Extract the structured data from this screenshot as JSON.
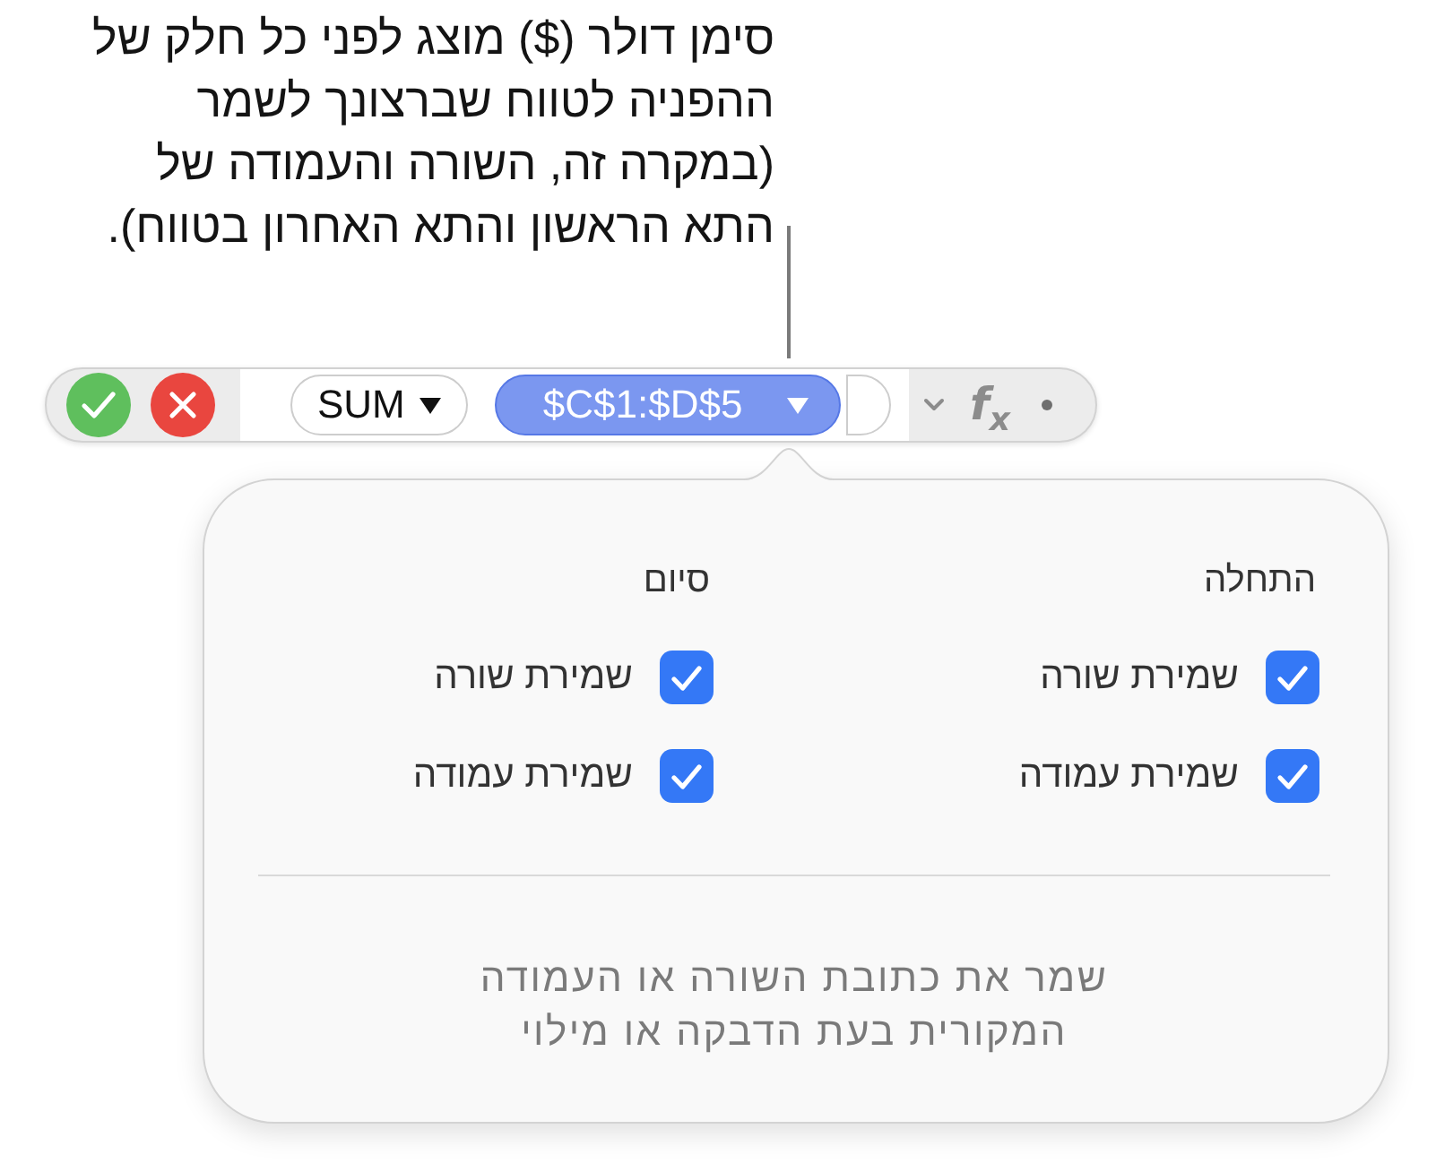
{
  "callout": {
    "text": "סימן דולר ($) מוצג לפני כל חלק של ההפניה לטווח שברצונך לשמר (במקרה זה, השורה והעמודה של התא הראשון והתא האחרון בטווח)."
  },
  "formula_bar": {
    "function_token": {
      "text": "SUM",
      "selected": false
    },
    "range_token": {
      "text": "$C$1:$D$5",
      "selected": true
    },
    "empty_token": {
      "selected": false
    },
    "function_symbol": "f$_{x}$"
  },
  "popover": {
    "columns": [
      {
        "heading": "התחלה",
        "options": [
          {
            "label": "שמירת שורה",
            "checked": true
          },
          {
            "label": "שמירת עמודה",
            "checked": true
          }
        ]
      },
      {
        "heading": "סיום",
        "options": [
          {
            "label": "שמירת שורה",
            "checked": true
          },
          {
            "label": "שמירת עמודה",
            "checked": true
          }
        ]
      }
    ],
    "note": "שמר את כתובת השורה או העמודה המקורית בעת הדבקה או מילוי"
  }
}
